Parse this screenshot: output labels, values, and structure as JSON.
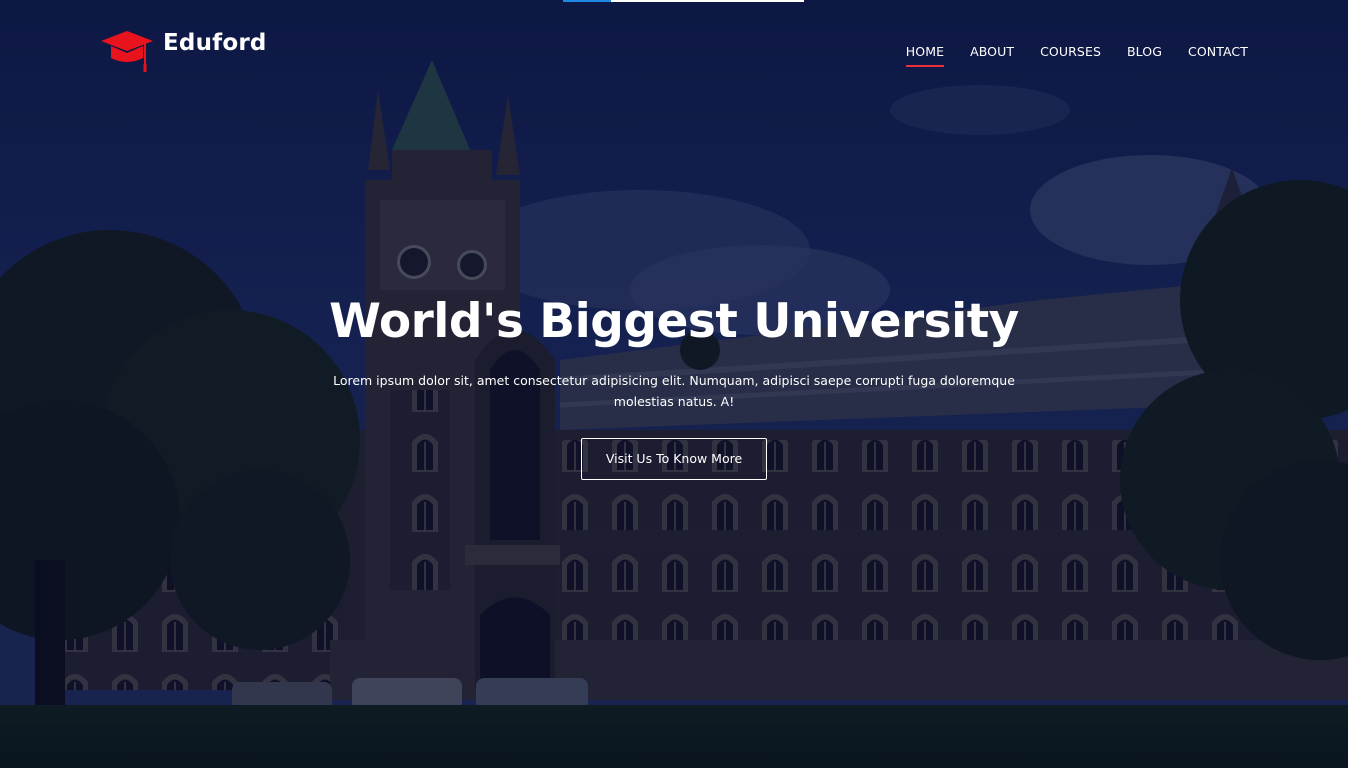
{
  "brand": {
    "name": "Eduford",
    "icon": "graduation-cap-icon",
    "icon_color": "#e8131d"
  },
  "nav": {
    "items": [
      {
        "label": "HOME",
        "active": true
      },
      {
        "label": "ABOUT",
        "active": false
      },
      {
        "label": "COURSES",
        "active": false
      },
      {
        "label": "BLOG",
        "active": false
      },
      {
        "label": "CONTACT",
        "active": false
      }
    ],
    "active_color": "#e8313a"
  },
  "hero": {
    "title": "World's Biggest University",
    "text": "Lorem ipsum dolor sit, amet consectetur adipisicing elit. Numquam, adipisci saepe corrupti fuga doloremque molestias natus. A!",
    "button_label": "Visit Us To Know More",
    "overlay_color": "#04092b",
    "background": "university-building-photo"
  },
  "page_load_progress": 0.2
}
